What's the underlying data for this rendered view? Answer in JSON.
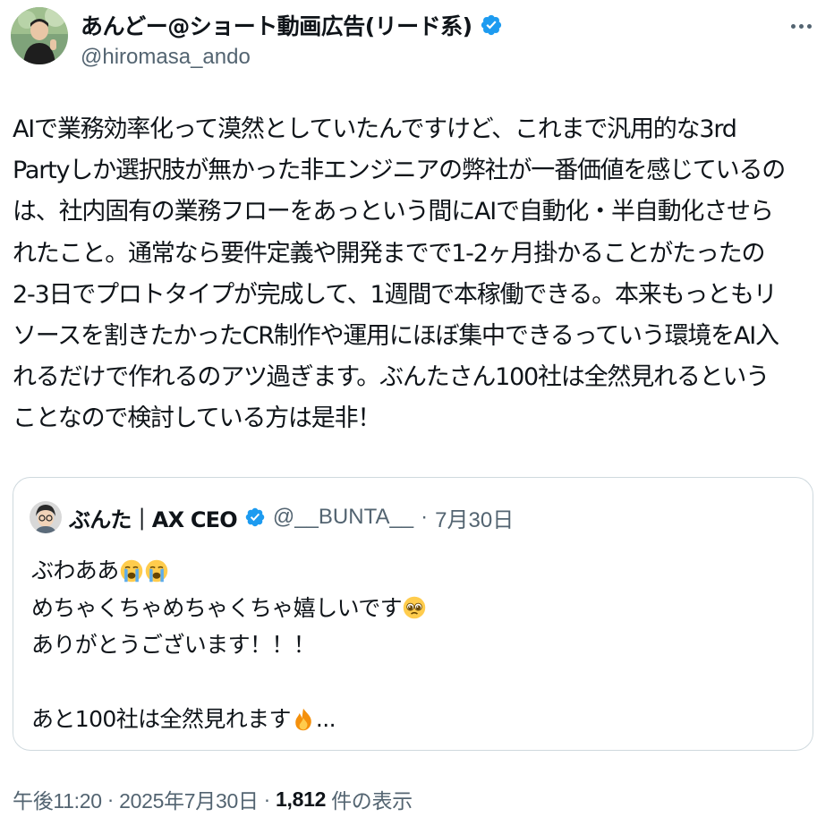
{
  "author": {
    "display_name": "あんどー@ショート動画広告(リード系)",
    "handle": "@hiromasa_ando",
    "verified_icon": "verified-badge-icon",
    "avatar_icon": "profile-avatar"
  },
  "more_icon": "more-dots-icon",
  "body_lines": [
    "AIで業務効率化って漠然としていたんですけど、これまで汎用的な3rd",
    "Partyしか選択肢が無かった非エンジニアの弊社が一番価値を感じているの",
    "は、社内固有の業務フローをあっという間にAIで自動化・半自動化させら",
    "れたこと。通常なら要件定義や開発までで1-2ヶ月掛かることがたったの",
    "2-3日でプロトタイプが完成して、1週間で本稼働できる。本来もっともリ",
    "ソースを割きたかったCR制作や運用にほぼ集中できるっていう環境をAI入",
    "れるだけで作れるのアツ過ぎます。ぶんたさん100社は全然見れるという",
    "ことなので検討している方は是非！"
  ],
  "quote": {
    "name": "ぶんた｜AX CEO",
    "handle": "@__BUNTA__",
    "separator": "·",
    "date": "7月30日",
    "lines": [
      {
        "text": "ぶわああ",
        "emojis": [
          "loudly-crying-face",
          "loudly-crying-face"
        ]
      },
      {
        "text": "めちゃくちゃめちゃくちゃ嬉しいです",
        "emojis": [
          "pleading-face"
        ]
      },
      {
        "text": "ありがとうございます！！！",
        "emojis": []
      },
      {
        "text": "",
        "emojis": []
      },
      {
        "text": "あと100社は全然見れます",
        "emojis": [
          "fire"
        ],
        "suffix": "..."
      }
    ]
  },
  "footer": {
    "time": "午後11:20",
    "sep1": "·",
    "date": "2025年7月30日",
    "sep2": "·",
    "views_count": "1,812",
    "views_label": "件の表示"
  },
  "colors": {
    "text": "#0f1419",
    "secondary": "#536471",
    "verified": "#1d9bf0",
    "border": "#cfd9de"
  }
}
